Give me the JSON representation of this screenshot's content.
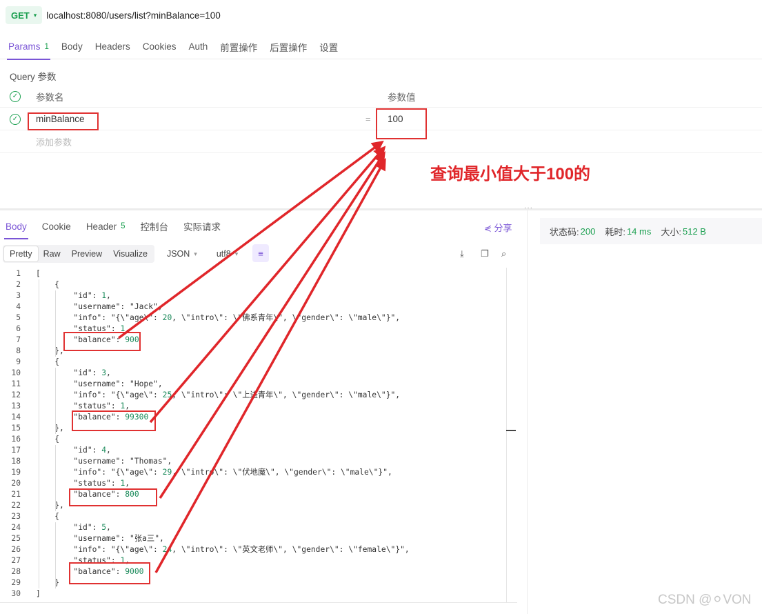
{
  "request": {
    "method": "GET",
    "url": "localhost:8080/users/list?minBalance=100"
  },
  "req_tabs": [
    {
      "label": "Params",
      "count": "1"
    },
    {
      "label": "Body"
    },
    {
      "label": "Headers"
    },
    {
      "label": "Cookies"
    },
    {
      "label": "Auth"
    },
    {
      "label": "前置操作"
    },
    {
      "label": "后置操作"
    },
    {
      "label": "设置"
    }
  ],
  "params": {
    "section_title": "Query 参数",
    "key_header": "参数名",
    "value_header": "参数值",
    "rows": [
      {
        "key": "minBalance",
        "value": "100"
      }
    ],
    "add_placeholder": "添加参数"
  },
  "annotation": {
    "text": "查询最小值大于100的",
    "color": "#e0262a"
  },
  "resp_tabs": [
    {
      "label": "Body"
    },
    {
      "label": "Cookie"
    },
    {
      "label": "Header",
      "count": "5"
    },
    {
      "label": "控制台"
    },
    {
      "label": "实际请求"
    }
  ],
  "share_label": "分享",
  "status": {
    "code_label": "状态码:",
    "code": "200",
    "time_label": "耗时:",
    "time": "14 ms",
    "size_label": "大小:",
    "size": "512 B"
  },
  "format_bar": {
    "modes": [
      "Pretty",
      "Raw",
      "Preview",
      "Visualize"
    ],
    "type": "JSON",
    "encoding": "utf8"
  },
  "response_lines": [
    "[",
    "    {",
    "        \"id\": 1,",
    "        \"username\": \"Jack\",",
    "        \"info\": \"{\\\"age\\\": 20, \\\"intro\\\": \\\"佛系青年\\\", \\\"gender\\\": \\\"male\\\"}\",",
    "        \"status\": 1,",
    "        \"balance\": 900",
    "    },",
    "    {",
    "        \"id\": 3,",
    "        \"username\": \"Hope\",",
    "        \"info\": \"{\\\"age\\\": 25, \\\"intro\\\": \\\"上进青年\\\", \\\"gender\\\": \\\"male\\\"}\",",
    "        \"status\": 1,",
    "        \"balance\": 99300",
    "    },",
    "    {",
    "        \"id\": 4,",
    "        \"username\": \"Thomas\",",
    "        \"info\": \"{\\\"age\\\": 29, \\\"intro\\\": \\\"伏地魔\\\", \\\"gender\\\": \\\"male\\\"}\",",
    "        \"status\": 1,",
    "        \"balance\": 800",
    "    },",
    "    {",
    "        \"id\": 5,",
    "        \"username\": \"张a三\",",
    "        \"info\": \"{\\\"age\\\": 24, \\\"intro\\\": \\\"英文老师\\\", \\\"gender\\\": \\\"female\\\"}\",",
    "        \"status\": 1,",
    "        \"balance\": 9000",
    "    }",
    "]"
  ],
  "watermark": "CSDN @⚪VON"
}
